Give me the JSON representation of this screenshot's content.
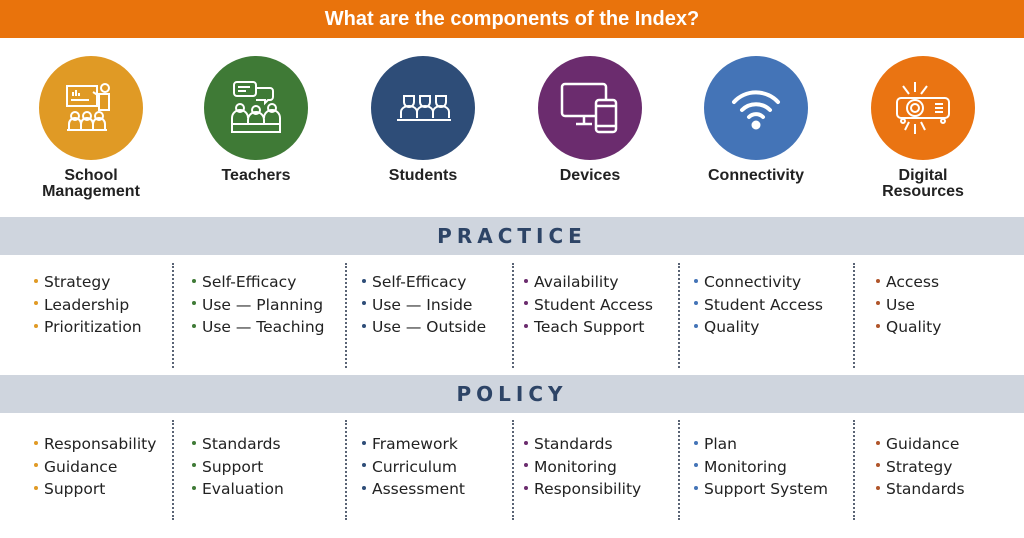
{
  "title": "What are the components of the Index?",
  "components": [
    {
      "label_lines": [
        "School",
        "Management"
      ],
      "icon": "teacher-whiteboard-icon",
      "color": "#e09a25"
    },
    {
      "label_lines": [
        "Teachers"
      ],
      "icon": "teachers-discussion-icon",
      "color": "#3f7a36"
    },
    {
      "label_lines": [
        "Students"
      ],
      "icon": "students-icon",
      "color": "#2e4d78"
    },
    {
      "label_lines": [
        "Devices"
      ],
      "icon": "devices-icon",
      "color": "#6b2c6e"
    },
    {
      "label_lines": [
        "Connectivity"
      ],
      "icon": "wifi-icon",
      "color": "#4474b7"
    },
    {
      "label_lines": [
        "Digital",
        "Resources"
      ],
      "icon": "projector-icon",
      "color": "#ea7412"
    }
  ],
  "practice": {
    "heading": "PRACTICE",
    "columns": [
      [
        "Strategy",
        "Leadership",
        "Prioritization"
      ],
      [
        "Self-Efficacy",
        "Use — Planning",
        "Use — Teaching"
      ],
      [
        "Self-Efficacy",
        "Use — Inside",
        "Use — Outside"
      ],
      [
        "Availability",
        "Student Access",
        "Teach Support"
      ],
      [
        "Connectivity",
        "Student Access",
        "Quality"
      ],
      [
        "Access",
        "Use",
        "Quality"
      ]
    ]
  },
  "policy": {
    "heading": "POLICY",
    "columns": [
      [
        "Responsability",
        "Guidance",
        "Support"
      ],
      [
        "Standards",
        "Support",
        "Evaluation"
      ],
      [
        "Framework",
        "Curriculum",
        "Assessment"
      ],
      [
        "Standards",
        "Monitoring",
        "Responsibility"
      ],
      [
        "Plan",
        "Monitoring",
        "Support System"
      ],
      [
        "Guidance",
        "Strategy",
        "Standards"
      ]
    ]
  },
  "bullet_colors": [
    "#e09a25",
    "#3f7a36",
    "#2e4d78",
    "#6b2c6e",
    "#4474b7",
    "#b0552a"
  ]
}
